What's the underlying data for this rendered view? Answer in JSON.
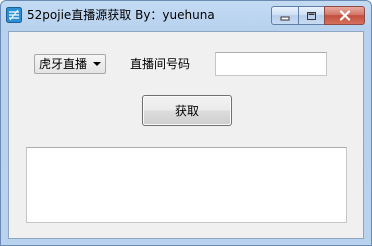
{
  "window": {
    "title": "52pojie直播源获取 By：yuehuna"
  },
  "controls": {
    "platform_select": {
      "value": "虎牙直播"
    },
    "room_label": "直播间号码",
    "room_input": {
      "value": "",
      "placeholder": ""
    },
    "fetch_button_label": "获取",
    "output_text": ""
  },
  "icons": {
    "app": "app-icon",
    "minimize": "minimize-icon",
    "maximize": "maximize-icon",
    "close": "close-icon",
    "dropdown": "chevron-down-icon"
  },
  "colors": {
    "titlebar": "#b9d3ef",
    "client_bg": "#f0f0f0",
    "close_button": "#c24f3e"
  }
}
